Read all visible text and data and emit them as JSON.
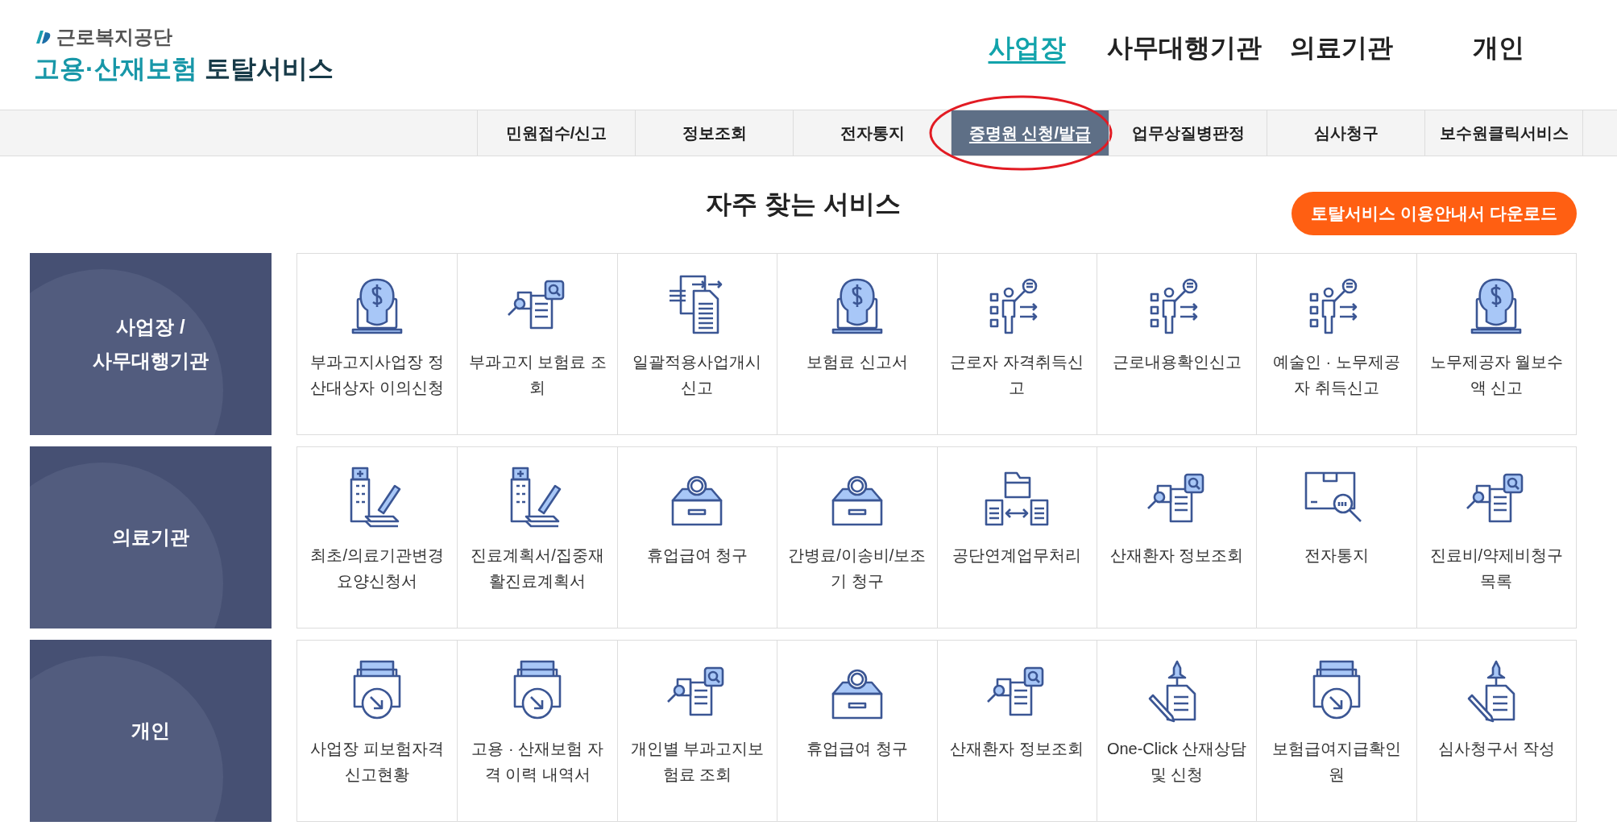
{
  "logo": {
    "org": "근로복지공단",
    "title_accent": "고용·산재보험",
    "title_main": "토탈서비스"
  },
  "top_nav": [
    {
      "label": "사업장",
      "selected": true
    },
    {
      "label": "사무대행기관",
      "selected": false
    },
    {
      "label": "의료기관",
      "selected": false
    },
    {
      "label": "개인",
      "selected": false
    }
  ],
  "sub_nav": [
    {
      "label": "민원접수/신고",
      "selected": false,
      "circled": false
    },
    {
      "label": "정보조회",
      "selected": false,
      "circled": false
    },
    {
      "label": "전자통지",
      "selected": false,
      "circled": false
    },
    {
      "label": "증명원 신청/발급",
      "selected": true,
      "circled": true
    },
    {
      "label": "업무상질병판정",
      "selected": false,
      "circled": false
    },
    {
      "label": "심사청구",
      "selected": false,
      "circled": false
    },
    {
      "label": "보수원클릭서비스",
      "selected": false,
      "circled": false
    }
  ],
  "section_title": "자주 찾는 서비스",
  "download_button": "토탈서비스 이용안내서 다운로드",
  "categories": [
    {
      "lines": [
        "사업장 /",
        "사무대행기관"
      ],
      "services": [
        {
          "label": "부과고지사업장 정산대상자 이의신청",
          "kind": "bulb"
        },
        {
          "label": "부과고지 보험료 조회",
          "kind": "search"
        },
        {
          "label": "일괄적용사업개시신고",
          "kind": "docs"
        },
        {
          "label": "보험료 신고서",
          "kind": "bulb"
        },
        {
          "label": "근로자 자격취득신고",
          "kind": "presenter"
        },
        {
          "label": "근로내용확인신고",
          "kind": "presenter"
        },
        {
          "label": "예술인 · 노무제공자 취득신고",
          "kind": "presenter"
        },
        {
          "label": "노무제공자 월보수액 신고",
          "kind": "bulb"
        }
      ]
    },
    {
      "lines": [
        "의료기관"
      ],
      "services": [
        {
          "label": "최초/의료기관변경 요양신청서",
          "kind": "hospital"
        },
        {
          "label": "진료계획서/집중재활진료계획서",
          "kind": "hospital"
        },
        {
          "label": "휴업급여 청구",
          "kind": "coinbox"
        },
        {
          "label": "간병료/이송비/보조기 청구",
          "kind": "coinbox"
        },
        {
          "label": "공단연계업무처리",
          "kind": "exchange"
        },
        {
          "label": "산재환자 정보조회",
          "kind": "search"
        },
        {
          "label": "전자통지",
          "kind": "parcel"
        },
        {
          "label": "진료비/약제비청구 목록",
          "kind": "search"
        }
      ]
    },
    {
      "lines": [
        "개인"
      ],
      "services": [
        {
          "label": "사업장 피보험자격 신고현황",
          "kind": "tray"
        },
        {
          "label": "고용 · 산재보험 자격 이력 내역서",
          "kind": "tray"
        },
        {
          "label": "개인별 부과고지보험료 조회",
          "kind": "search"
        },
        {
          "label": "휴업급여 청구",
          "kind": "coinbox"
        },
        {
          "label": "산재환자 정보조회",
          "kind": "search"
        },
        {
          "label": "One-Click 산재상담 및 신청",
          "kind": "pen"
        },
        {
          "label": "보험급여지급확인원",
          "kind": "tray"
        },
        {
          "label": "심사청구서 작성",
          "kind": "pen"
        }
      ]
    }
  ]
}
